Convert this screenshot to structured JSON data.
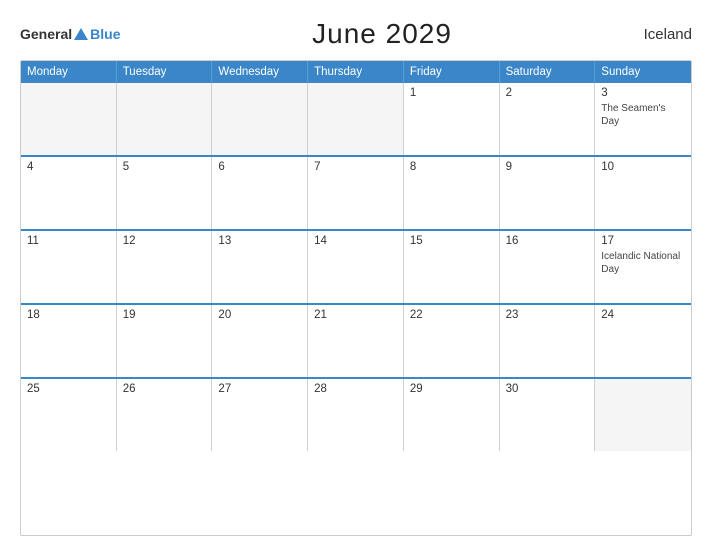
{
  "header": {
    "logo_general": "General",
    "logo_blue": "Blue",
    "title": "June 2029",
    "country": "Iceland"
  },
  "weekdays": [
    "Monday",
    "Tuesday",
    "Wednesday",
    "Thursday",
    "Friday",
    "Saturday",
    "Sunday"
  ],
  "weeks": [
    [
      {
        "day": "",
        "empty": true
      },
      {
        "day": "",
        "empty": true
      },
      {
        "day": "",
        "empty": true
      },
      {
        "day": "",
        "empty": true
      },
      {
        "day": "1",
        "empty": false,
        "holiday": ""
      },
      {
        "day": "2",
        "empty": false,
        "holiday": ""
      },
      {
        "day": "3",
        "empty": false,
        "holiday": "The Seamen's Day"
      }
    ],
    [
      {
        "day": "4",
        "empty": false,
        "holiday": ""
      },
      {
        "day": "5",
        "empty": false,
        "holiday": ""
      },
      {
        "day": "6",
        "empty": false,
        "holiday": ""
      },
      {
        "day": "7",
        "empty": false,
        "holiday": ""
      },
      {
        "day": "8",
        "empty": false,
        "holiday": ""
      },
      {
        "day": "9",
        "empty": false,
        "holiday": ""
      },
      {
        "day": "10",
        "empty": false,
        "holiday": ""
      }
    ],
    [
      {
        "day": "11",
        "empty": false,
        "holiday": ""
      },
      {
        "day": "12",
        "empty": false,
        "holiday": ""
      },
      {
        "day": "13",
        "empty": false,
        "holiday": ""
      },
      {
        "day": "14",
        "empty": false,
        "holiday": ""
      },
      {
        "day": "15",
        "empty": false,
        "holiday": ""
      },
      {
        "day": "16",
        "empty": false,
        "holiday": ""
      },
      {
        "day": "17",
        "empty": false,
        "holiday": "Icelandic National Day"
      }
    ],
    [
      {
        "day": "18",
        "empty": false,
        "holiday": ""
      },
      {
        "day": "19",
        "empty": false,
        "holiday": ""
      },
      {
        "day": "20",
        "empty": false,
        "holiday": ""
      },
      {
        "day": "21",
        "empty": false,
        "holiday": ""
      },
      {
        "day": "22",
        "empty": false,
        "holiday": ""
      },
      {
        "day": "23",
        "empty": false,
        "holiday": ""
      },
      {
        "day": "24",
        "empty": false,
        "holiday": ""
      }
    ],
    [
      {
        "day": "25",
        "empty": false,
        "holiday": ""
      },
      {
        "day": "26",
        "empty": false,
        "holiday": ""
      },
      {
        "day": "27",
        "empty": false,
        "holiday": ""
      },
      {
        "day": "28",
        "empty": false,
        "holiday": ""
      },
      {
        "day": "29",
        "empty": false,
        "holiday": ""
      },
      {
        "day": "30",
        "empty": false,
        "holiday": ""
      },
      {
        "day": "",
        "empty": true
      }
    ]
  ]
}
